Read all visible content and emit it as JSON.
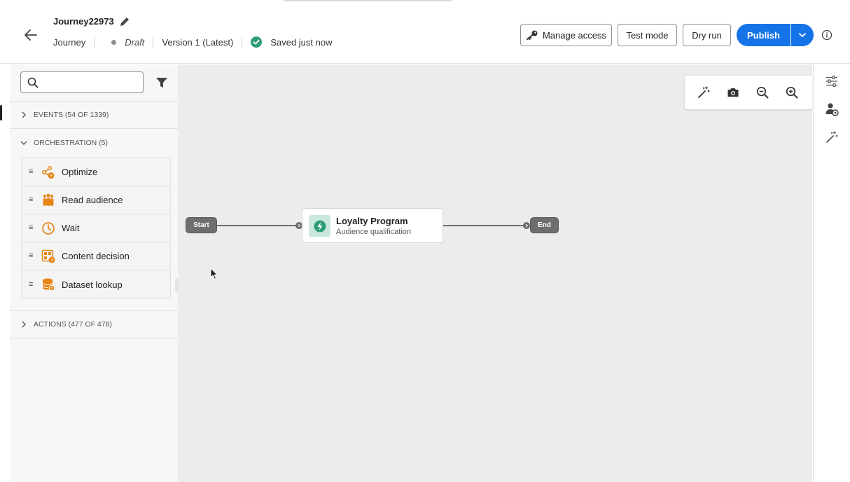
{
  "header": {
    "journey_name": "Journey22973",
    "type_label": "Journey",
    "status": "Draft",
    "version": "Version 1 (Latest)",
    "save_status": "Saved just now",
    "buttons": {
      "manage_access": "Manage access",
      "test_mode": "Test mode",
      "dry_run": "Dry run",
      "publish": "Publish"
    },
    "icons": {
      "back": "arrow-left-icon",
      "edit": "pencil-icon",
      "saved": "check-circle-icon",
      "manage_access": "key-icon",
      "publish_more": "chevron-down-icon",
      "info": "info-icon"
    }
  },
  "left_panel": {
    "search": {
      "value": "",
      "placeholder": ""
    },
    "sections": {
      "events": "EVENTS (54 OF 1339)",
      "orchestration": "ORCHESTRATION (5)",
      "actions": "ACTIONS (477 OF 478)"
    },
    "orchestration_items": [
      {
        "label": "Optimize",
        "icon": "optimize-icon"
      },
      {
        "label": "Read audience",
        "icon": "audience-icon"
      },
      {
        "label": "Wait",
        "icon": "clock-icon"
      },
      {
        "label": "Content decision",
        "icon": "content-decision-icon"
      },
      {
        "label": "Dataset lookup",
        "icon": "database-icon"
      }
    ]
  },
  "canvas": {
    "start_label": "Start",
    "end_label": "End",
    "activity": {
      "title": "Loyalty Program",
      "subtitle": "Audience qualification",
      "icon": "lightning-icon"
    },
    "toolbar": [
      "magic-wand-icon",
      "camera-icon",
      "zoom-out-icon",
      "zoom-in-icon"
    ]
  },
  "right_rail": [
    "settings-sliders-icon",
    "user-settings-icon",
    "magic-wand-icon"
  ],
  "colors": {
    "accent": "#1473e6",
    "orchestration_icon": "#e68619",
    "activity_icon_bg": "#cbe8df",
    "activity_icon": "#2d9d78",
    "saved_check": "#2d9d78"
  }
}
